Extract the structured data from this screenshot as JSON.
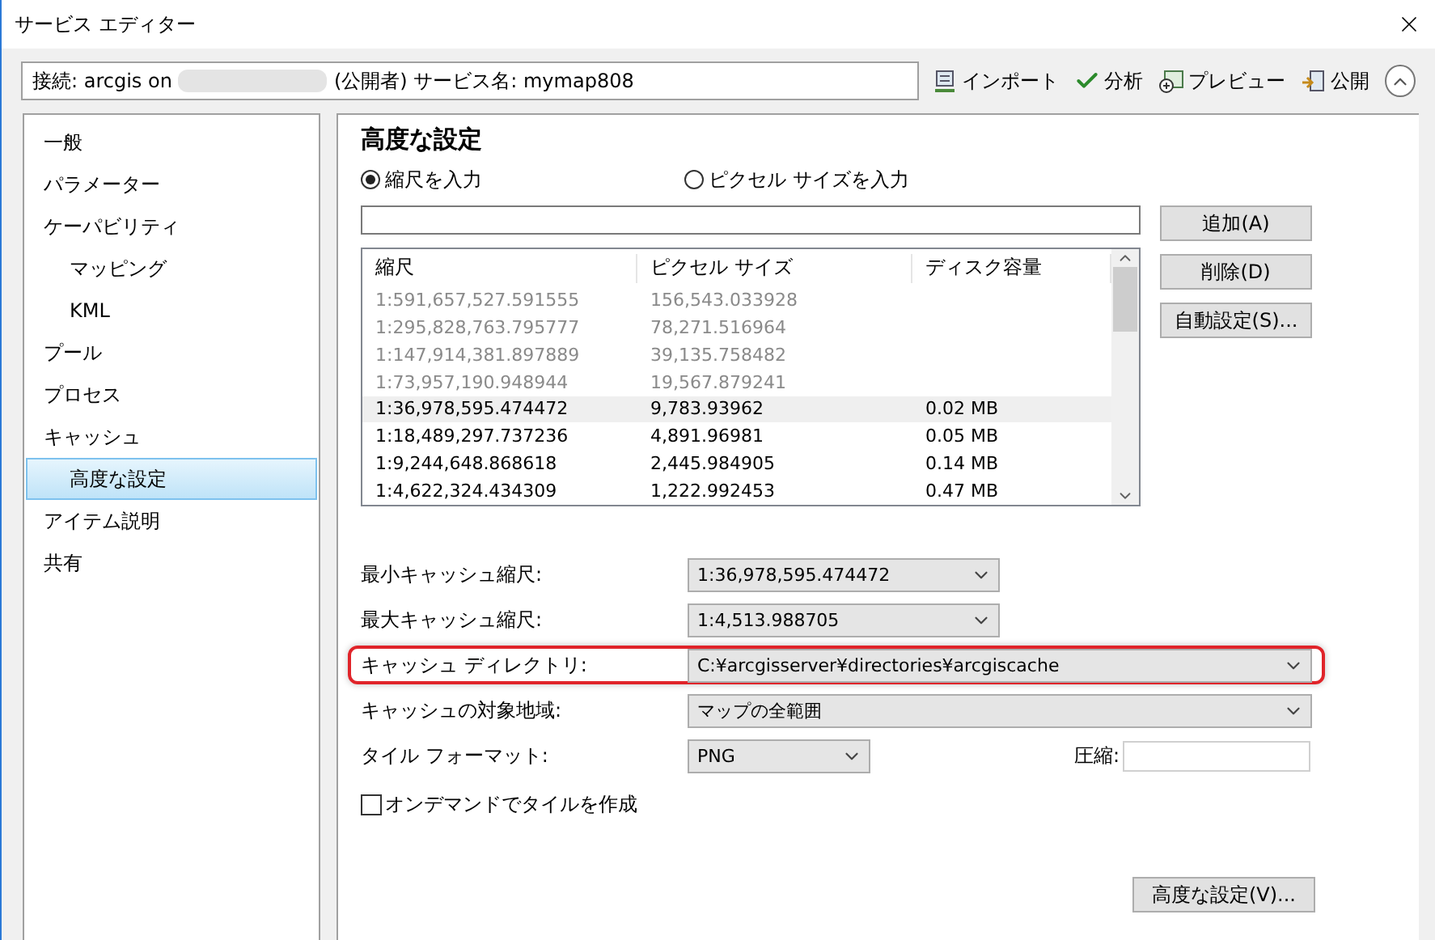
{
  "window": {
    "title": "サービス エディター"
  },
  "connection": {
    "prefix": "接続: arcgis on",
    "suffix": "(公開者)  サービス名: mymap808"
  },
  "toolbar": [
    {
      "kind": "import",
      "label": "インポート"
    },
    {
      "kind": "analyze",
      "label": "分析"
    },
    {
      "kind": "preview",
      "label": "プレビュー"
    },
    {
      "kind": "publish",
      "label": "公開"
    }
  ],
  "sidebar": {
    "items": [
      {
        "label": "一般",
        "selected": false
      },
      {
        "label": "パラメーター",
        "selected": false
      },
      {
        "label": "ケーパビリティ",
        "selected": false,
        "children": [
          {
            "label": "マッピング",
            "selected": false
          },
          {
            "label": "KML",
            "selected": false
          }
        ]
      },
      {
        "label": "プール",
        "selected": false
      },
      {
        "label": "プロセス",
        "selected": false
      },
      {
        "label": "キャッシュ",
        "selected": false,
        "children": [
          {
            "label": "高度な設定",
            "selected": true
          }
        ]
      },
      {
        "label": "アイテム説明",
        "selected": false
      },
      {
        "label": "共有",
        "selected": false
      }
    ]
  },
  "heading": "高度な設定",
  "input_mode": [
    {
      "label": "縮尺を入力",
      "selected": true
    },
    {
      "label": "ピクセル サイズを入力",
      "selected": false
    }
  ],
  "table": {
    "columns": [
      "縮尺",
      "ピクセル サイズ",
      "ディスク容量"
    ],
    "rows": [
      {
        "cells": [
          "1:591,657,527.591555",
          "156,543.033928",
          ""
        ],
        "enabled": false,
        "selected": false
      },
      {
        "cells": [
          "1:295,828,763.795777",
          "78,271.516964",
          ""
        ],
        "enabled": false,
        "selected": false
      },
      {
        "cells": [
          "1:147,914,381.897889",
          "39,135.758482",
          ""
        ],
        "enabled": false,
        "selected": false
      },
      {
        "cells": [
          "1:73,957,190.948944",
          "19,567.879241",
          ""
        ],
        "enabled": false,
        "selected": false
      },
      {
        "cells": [
          "1:36,978,595.474472",
          "9,783.93962",
          "0.02 MB"
        ],
        "enabled": true,
        "selected": true
      },
      {
        "cells": [
          "1:18,489,297.737236",
          "4,891.96981",
          "0.05 MB"
        ],
        "enabled": true,
        "selected": false
      },
      {
        "cells": [
          "1:9,244,648.868618",
          "2,445.984905",
          "0.14 MB"
        ],
        "enabled": true,
        "selected": false
      },
      {
        "cells": [
          "1:4,622,324.434309",
          "1,222.992453",
          "0.47 MB"
        ],
        "enabled": true,
        "selected": false
      }
    ]
  },
  "scale_buttons": [
    "追加(A)",
    "削除(D)",
    "自動設定(S)..."
  ],
  "settings": [
    {
      "label": "最小キャッシュ縮尺:",
      "value": "1:36,978,595.474472",
      "kind": "medium",
      "highlighted": false
    },
    {
      "label": "最大キャッシュ縮尺:",
      "value": "1:4,513.988705",
      "kind": "medium",
      "highlighted": false
    },
    {
      "label": "キャッシュ ディレクトリ:",
      "value": "C:¥arcgisserver¥directories¥arcgiscache",
      "kind": "wide",
      "highlighted": true
    },
    {
      "label": "キャッシュの対象地域:",
      "value": "マップの全範囲",
      "kind": "wide",
      "highlighted": false
    },
    {
      "label": "タイル フォーマット:",
      "value": "PNG",
      "kind": "short",
      "highlighted": false,
      "extra_label": "圧縮:"
    }
  ],
  "on_demand": {
    "label": "オンデマンドでタイルを作成",
    "checked": false
  },
  "advanced_button": "高度な設定(V)..."
}
